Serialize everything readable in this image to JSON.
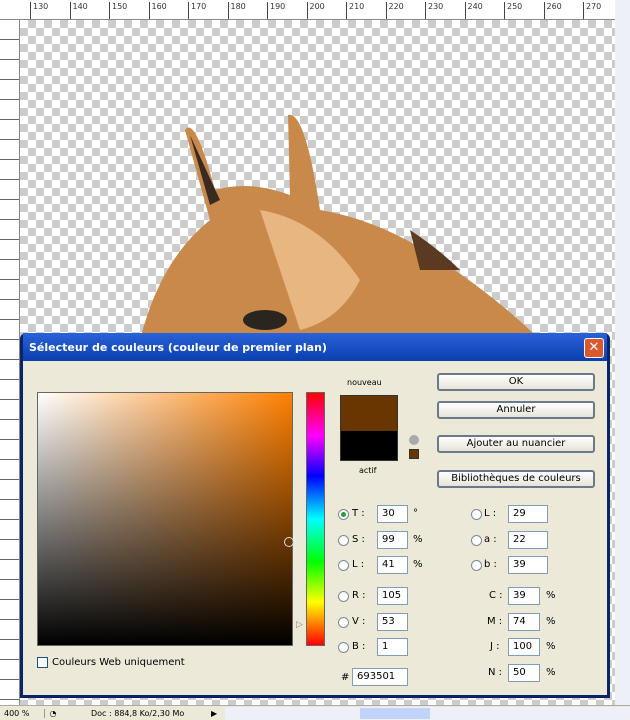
{
  "ruler": {
    "top_ticks": [
      "130",
      "140",
      "150",
      "160",
      "170",
      "180",
      "190",
      "200",
      "210",
      "220",
      "230",
      "240",
      "250",
      "260",
      "270"
    ]
  },
  "dialog": {
    "title": "Sélecteur de couleurs (couleur de premier plan)",
    "close_label": "✕",
    "swatch_new_label": "nouveau",
    "swatch_current_label": "actif",
    "new_color": "#693501",
    "current_color": "#000000",
    "buttons": {
      "ok": "OK",
      "cancel": "Annuler",
      "add_swatch": "Ajouter au nuancier",
      "libraries": "Bibliothèques de couleurs"
    },
    "web_only_label": "Couleurs Web uniquement",
    "web_only_checked": false,
    "hsb": [
      {
        "label": "T :",
        "value": "30",
        "unit": "°",
        "selected": true
      },
      {
        "label": "S :",
        "value": "99",
        "unit": "%",
        "selected": false
      },
      {
        "label": "L :",
        "value": "41",
        "unit": "%",
        "selected": false
      }
    ],
    "rgb": [
      {
        "label": "R :",
        "value": "105"
      },
      {
        "label": "V :",
        "value": "53"
      },
      {
        "label": "B :",
        "value": "1"
      }
    ],
    "lab": [
      {
        "label": "L :",
        "value": "29"
      },
      {
        "label": "a :",
        "value": "22"
      },
      {
        "label": "b :",
        "value": "39"
      }
    ],
    "cmyk": [
      {
        "label": "C :",
        "value": "39",
        "unit": "%"
      },
      {
        "label": "M :",
        "value": "74",
        "unit": "%"
      },
      {
        "label": "J :",
        "value": "100",
        "unit": "%"
      },
      {
        "label": "N :",
        "value": "50",
        "unit": "%"
      }
    ],
    "hex_label": "#",
    "hex": "693501"
  },
  "status": {
    "zoom": "400 %",
    "doc": "Doc : 884,8 Ko/2,30 Mo"
  }
}
